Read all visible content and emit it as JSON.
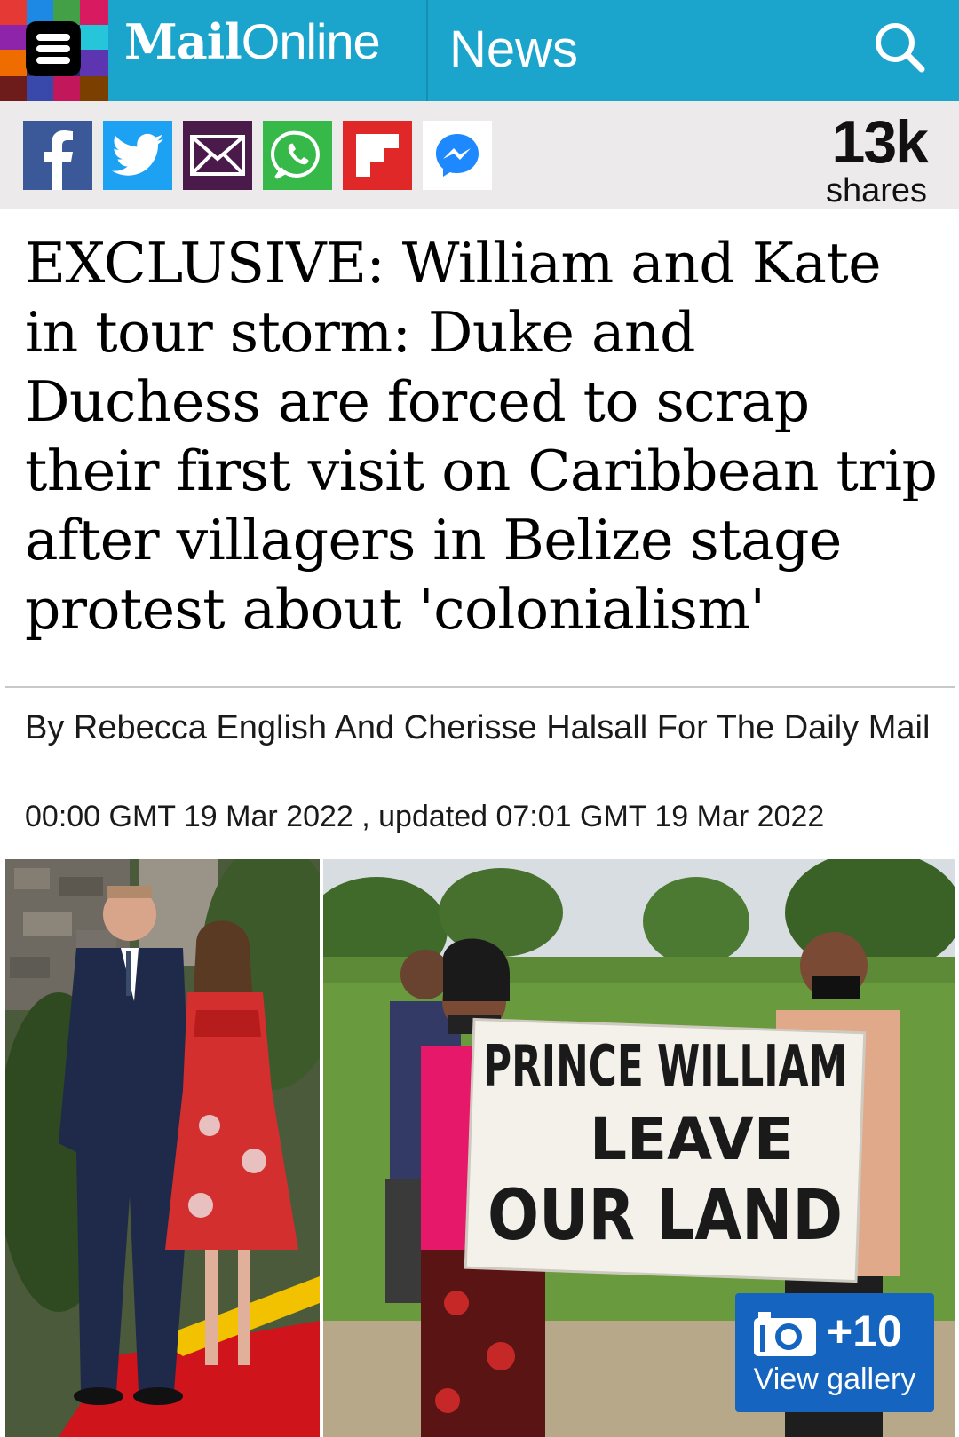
{
  "header": {
    "logo_mail": "Mail",
    "logo_online": "Online",
    "section": "News",
    "brand_color": "#1ba4cc"
  },
  "share_bar": {
    "buttons": [
      {
        "name": "facebook",
        "color": "#3b5998"
      },
      {
        "name": "twitter",
        "color": "#1da1f2"
      },
      {
        "name": "email",
        "color": "#4a1a4a"
      },
      {
        "name": "whatsapp",
        "color": "#37b94a"
      },
      {
        "name": "flipboard",
        "color": "#e12828"
      },
      {
        "name": "messenger",
        "color": "#ffffff"
      }
    ],
    "share_count": "13k",
    "share_label": "shares"
  },
  "article": {
    "headline": "EXCLUSIVE: William and Kate in tour storm: Duke and Duchess are forced to scrap their first visit on Caribbean trip after villagers in Belize stage protest about 'colonialism'",
    "byline": "By Rebecca English And Cherisse Halsall For The Daily Mail",
    "dateline": "00:00 GMT 19 Mar 2022 , updated 07:01 GMT 19 Mar 2022"
  },
  "images": {
    "sign_line1": "PRINCE WILLIAM",
    "sign_line2": "LEAVE",
    "sign_line3": "OUR LAND"
  },
  "gallery": {
    "count": "+10",
    "label": "View gallery"
  }
}
